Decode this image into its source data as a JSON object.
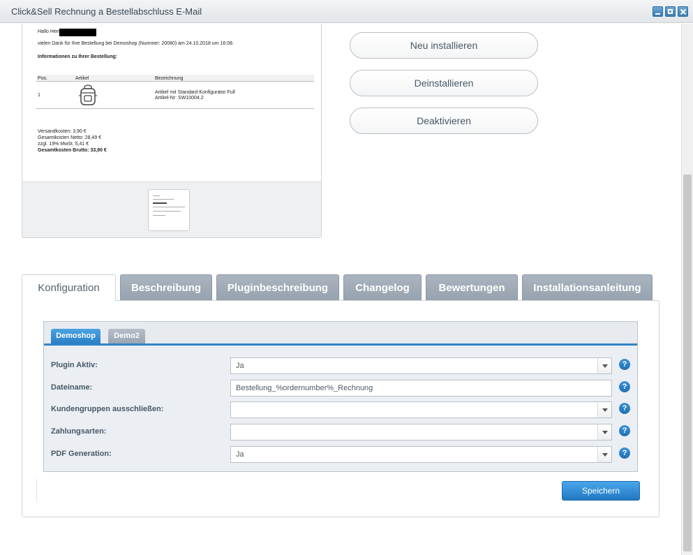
{
  "window": {
    "title": "Click&Sell Rechnung a Bestellabschluss E-Mail"
  },
  "preview": {
    "greeting": "Hallo Herr",
    "thanks": "vielen Dank für Ihre Bestellung bei Demoshop (Nummer: 20080) am 24.10.2018 um 16:08.",
    "info_heading": "Informationen zu Ihrer Bestellung:",
    "table_headers": [
      "Pos.",
      "Artikel",
      "Bezeichnung"
    ],
    "row_pos": "1",
    "row_desc_1": "Artikel mit Standard-Konfigurator Full",
    "row_desc_2": "Artikel-Nr: SW10004.2",
    "shipping": "Versandkosten: 3,90 €",
    "net": "Gesamtkosten Netto: 28,49 €",
    "vat": "zzgl. 19% MwSt. 5,41 €",
    "gross": "Gesamtkosten Brutto: 33,90 €"
  },
  "actions": {
    "reinstall": "Neu installieren",
    "uninstall": "Deinstallieren",
    "deactivate": "Deaktivieren"
  },
  "tabs": [
    "Konfiguration",
    "Beschreibung",
    "Pluginbeschreibung",
    "Changelog",
    "Bewertungen",
    "Installationsanleitung"
  ],
  "shop_tabs": [
    "Demoshop",
    "Demo2"
  ],
  "form": {
    "plugin_active_label": "Plugin Aktiv:",
    "plugin_active_value": "Ja",
    "filename_label": "Dateiname:",
    "filename_value": "Bestellung_%ordernumber%_Rechnung",
    "customer_groups_label": "Kundengruppen ausschließen:",
    "customer_groups_value": "",
    "payment_label": "Zahlungsarten:",
    "payment_value": "",
    "pdf_label": "PDF Generation:",
    "pdf_value": "Ja",
    "help_glyph": "?"
  },
  "save_label": "Speichern",
  "colors": {
    "accent": "#2f84c8",
    "tab_inactive": "#9ca8b4"
  }
}
